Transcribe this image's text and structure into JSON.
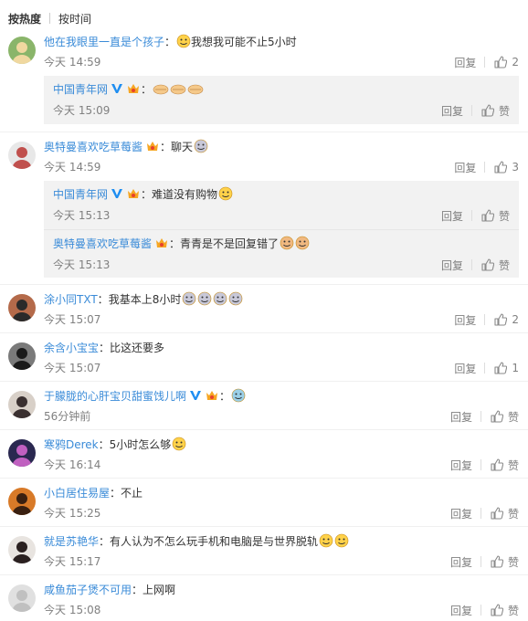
{
  "sort": {
    "hot": "按热度",
    "time": "按时间"
  },
  "labels": {
    "reply": "回复",
    "like_empty": "赞"
  },
  "comments": [
    {
      "user": "他在我眼里一直是个孩子",
      "text": "我想我可能不止5小时",
      "time": "今天 14:59",
      "likes": "2",
      "avatar": {
        "bg": "#8ab56a",
        "fg": "#f0d8a0"
      },
      "replies": [
        {
          "user": "中国青年网",
          "text": "",
          "time": "今天 15:09",
          "likes": ""
        }
      ]
    },
    {
      "user": "奥特曼喜欢吃草莓酱",
      "text": "聊天",
      "time": "今天 14:59",
      "likes": "3",
      "avatar": {
        "bg": "#e8e8e8",
        "fg": "#c0504d"
      },
      "replies": [
        {
          "user": "中国青年网",
          "text": "难道没有购物",
          "time": "今天 15:13",
          "likes": ""
        },
        {
          "user": "奥特曼喜欢吃草莓酱",
          "text": "青青是不是回复错了",
          "time": "今天 15:13",
          "likes": ""
        }
      ]
    },
    {
      "user": "涂小同TXT",
      "text": "我基本上8小时",
      "time": "今天 15:07",
      "likes": "2",
      "avatar": {
        "bg": "#b46a4a",
        "fg": "#2a2a2a"
      }
    },
    {
      "user": "余含小宝宝",
      "text": "比这还要多",
      "time": "今天 15:07",
      "likes": "1",
      "avatar": {
        "bg": "#7a7a7a",
        "fg": "#1a1a1a"
      }
    },
    {
      "user": "于朦胧的心肝宝贝甜蜜饯儿啊",
      "text": "",
      "time": "56分钟前",
      "likes": "",
      "avatar": {
        "bg": "#d8d0c8",
        "fg": "#3a3030"
      }
    },
    {
      "user": "寒鸦Derek",
      "text": "5小时怎么够",
      "time": "今天 16:14",
      "likes": "",
      "avatar": {
        "bg": "#2a2850",
        "fg": "#c060c0"
      }
    },
    {
      "user": "小白居住易屋",
      "text": "不止",
      "time": "今天 15:25",
      "likes": "",
      "avatar": {
        "bg": "#d87a28",
        "fg": "#3a2010"
      }
    },
    {
      "user": "就是苏艳华",
      "text": "有人认为不怎么玩手机和电脑是与世界脱轨",
      "time": "今天 15:17",
      "likes": "",
      "avatar": {
        "bg": "#e8e4e0",
        "fg": "#2a2020"
      }
    },
    {
      "user": "咸鱼茄子煲不可用",
      "text": "上网啊",
      "time": "今天 15:08",
      "likes": "",
      "avatar": {
        "bg": "#e0e0e0",
        "fg": "#c0c0c0"
      }
    }
  ]
}
